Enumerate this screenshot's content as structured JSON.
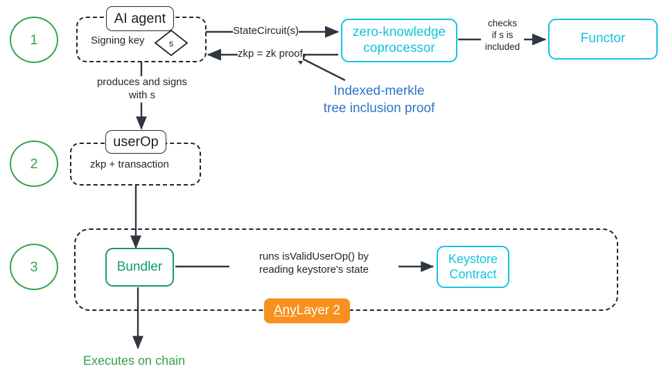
{
  "diagram": {
    "title": "zk keystore agent flow",
    "colors": {
      "green": "#35a24b",
      "cyan": "#12c4de",
      "teal": "#0f9b6d",
      "blue": "#2e74c8",
      "orange": "#f7901e",
      "ink": "#1d2229"
    }
  },
  "steps": [
    {
      "number": "1"
    },
    {
      "number": "2"
    },
    {
      "number": "3"
    }
  ],
  "nodes": {
    "ai_agent": {
      "title": "AI agent",
      "subtitle": "Signing key",
      "key_symbol": "s"
    },
    "zk_coprocessor": {
      "line1": "zero-knowledge",
      "line2": "coprocessor"
    },
    "functor": {
      "label": "Functor"
    },
    "user_op": {
      "title": "userOp",
      "subtitle": "zkp + transaction"
    },
    "bundler": {
      "label": "Bundler"
    },
    "keystore_contract": {
      "line1": "Keystore",
      "line2": "Contract"
    },
    "layer2_badge": {
      "emphasis": "Any",
      "rest": " Layer 2"
    }
  },
  "edges": {
    "state_circuit": "StateCircuit(s)",
    "zkp_return": "zkp = zk proof",
    "checks_line1": "checks",
    "checks_line2": "if s is",
    "checks_line3": "included",
    "produces_line1": "produces and signs",
    "produces_line2": "with s",
    "runs_line1": "runs isValidUserOp() by",
    "runs_line2": "reading keystore's state"
  },
  "annotations": {
    "merkle_line1": "Indexed-merkle",
    "merkle_line2": "tree inclusion proof",
    "executes_on_chain": "Executes on chain"
  }
}
